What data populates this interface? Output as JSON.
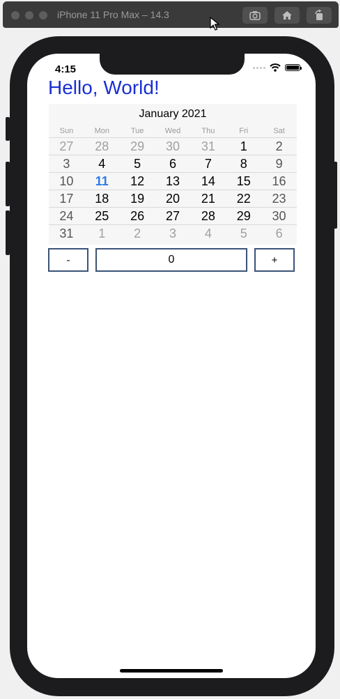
{
  "window": {
    "title": "iPhone 11 Pro Max – 14.3",
    "buttons": [
      "screenshot-icon",
      "home-icon",
      "rotate-icon"
    ]
  },
  "status_bar": {
    "time": "4:15"
  },
  "heading": {
    "text": "Hello, World!",
    "color": "#1a2fd1"
  },
  "calendar": {
    "title": "January 2021",
    "weekdays": [
      "Sun",
      "Mon",
      "Tue",
      "Wed",
      "Thu",
      "Fri",
      "Sat"
    ],
    "today_color": "#2f7ae5",
    "weeks": [
      [
        {
          "d": "27",
          "m": true
        },
        {
          "d": "28",
          "m": true
        },
        {
          "d": "29",
          "m": true
        },
        {
          "d": "30",
          "m": true
        },
        {
          "d": "31",
          "m": true
        },
        {
          "d": "1"
        },
        {
          "d": "2",
          "w": true
        }
      ],
      [
        {
          "d": "3",
          "w": true
        },
        {
          "d": "4"
        },
        {
          "d": "5"
        },
        {
          "d": "6"
        },
        {
          "d": "7"
        },
        {
          "d": "8"
        },
        {
          "d": "9",
          "w": true
        }
      ],
      [
        {
          "d": "10",
          "w": true
        },
        {
          "d": "11",
          "t": true
        },
        {
          "d": "12"
        },
        {
          "d": "13"
        },
        {
          "d": "14"
        },
        {
          "d": "15"
        },
        {
          "d": "16",
          "w": true
        }
      ],
      [
        {
          "d": "17",
          "w": true
        },
        {
          "d": "18"
        },
        {
          "d": "19"
        },
        {
          "d": "20"
        },
        {
          "d": "21"
        },
        {
          "d": "22"
        },
        {
          "d": "23",
          "w": true
        }
      ],
      [
        {
          "d": "24",
          "w": true
        },
        {
          "d": "25"
        },
        {
          "d": "26"
        },
        {
          "d": "27"
        },
        {
          "d": "28"
        },
        {
          "d": "29"
        },
        {
          "d": "30",
          "w": true
        }
      ],
      [
        {
          "d": "31",
          "w": true
        },
        {
          "d": "1",
          "m": true
        },
        {
          "d": "2",
          "m": true
        },
        {
          "d": "3",
          "m": true
        },
        {
          "d": "4",
          "m": true
        },
        {
          "d": "5",
          "m": true
        },
        {
          "d": "6",
          "m": true
        }
      ]
    ]
  },
  "counter": {
    "decrement_label": "-",
    "value": "0",
    "increment_label": "+",
    "border_color": "#3b5278"
  }
}
